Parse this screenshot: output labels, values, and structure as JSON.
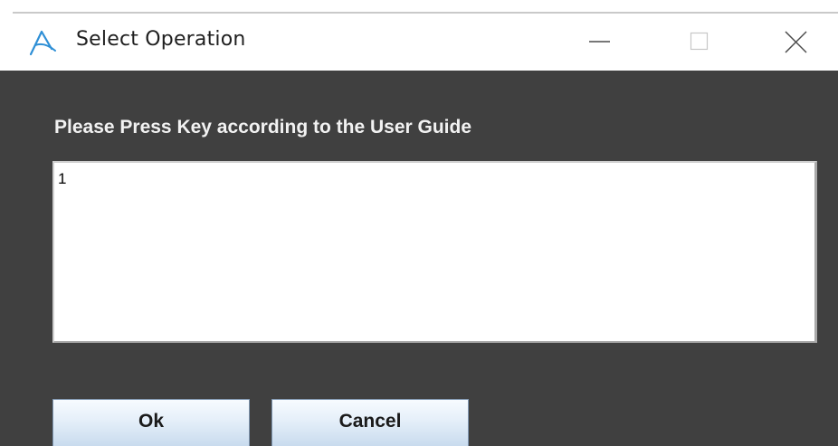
{
  "window": {
    "title": "Select Operation",
    "icon": "app-logo-icon",
    "controls": [
      "minimize-icon",
      "maximize-icon",
      "close-icon"
    ]
  },
  "dialog": {
    "prompt": "Please Press Key according to the User Guide",
    "input_value": "1",
    "buttons": {
      "ok_label": "Ok",
      "cancel_label": "Cancel"
    }
  },
  "colors": {
    "titlebar_bg": "#ffffff",
    "content_bg": "#404040",
    "prompt_text": "#f2f2f2",
    "icon_accent": "#2e8fd6",
    "button_gradient_top": "#f7fbff",
    "button_gradient_bottom": "#c9dbee"
  }
}
